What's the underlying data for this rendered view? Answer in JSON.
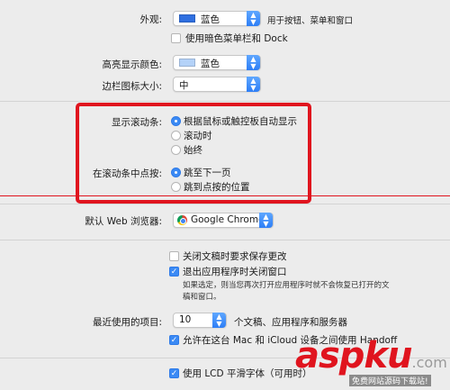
{
  "appearance": {
    "label": "外观:",
    "value": "蓝色",
    "swatch_color": "#2f6fe0",
    "hint": "用于按钮、菜单和窗口",
    "dark_menu_label": "使用暗色菜单栏和 Dock",
    "dark_menu_checked": false
  },
  "highlight": {
    "label": "高亮显示颜色:",
    "value": "蓝色",
    "swatch_color": "#b4d2f8"
  },
  "sidebar_icon": {
    "label": "边栏图标大小:",
    "value": "中"
  },
  "scrollbars": {
    "label": "显示滚动条:",
    "options": [
      "根据鼠标或触控板自动显示",
      "滚动时",
      "始终"
    ],
    "selected": 0
  },
  "click_scroll": {
    "label": "在滚动条中点按:",
    "options": [
      "跳至下一页",
      "跳到点按的位置"
    ],
    "selected": 0
  },
  "browser": {
    "label": "默认 Web 浏览器:",
    "value": "Google Chrome"
  },
  "docs": {
    "ask_save_label": "关闭文稿时要求保存更改",
    "ask_save_checked": false,
    "close_windows_label": "退出应用程序时关闭窗口",
    "close_windows_checked": true,
    "note": "如果选定，则当您再次打开应用程序时就不会恢复已打开的文稿和窗口。"
  },
  "recent": {
    "label": "最近使用的项目:",
    "value": "10",
    "suffix": "个文稿、应用程序和服务器"
  },
  "handoff": {
    "label": "允许在这台 Mac 和 iCloud 设备之间使用 Handoff",
    "checked": true
  },
  "lcd": {
    "label": "使用 LCD 平滑字体（可用时）",
    "checked": true
  },
  "annotation_color": "#e0141e",
  "watermark": {
    "brand": "aspku",
    "suffix": ".com",
    "tagline": "免费网站源码下载站!"
  }
}
